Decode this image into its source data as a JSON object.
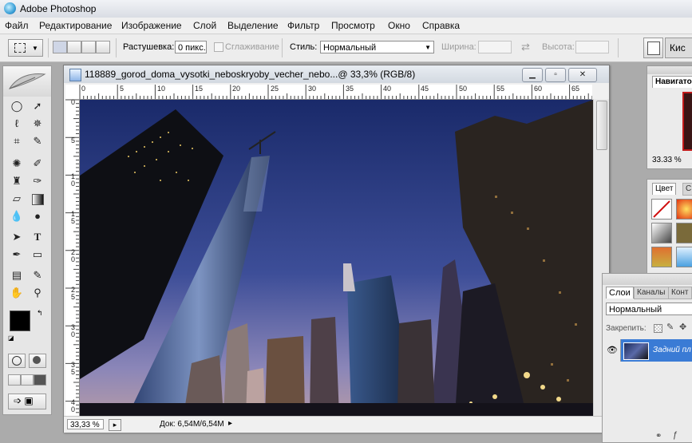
{
  "app": {
    "title": "Adobe Photoshop"
  },
  "menu": {
    "items": [
      "Файл",
      "Редактирование",
      "Изображение",
      "Слой",
      "Выделение",
      "Фильтр",
      "Просмотр",
      "Окно",
      "Справка"
    ]
  },
  "options": {
    "feather_label": "Растушевка:",
    "feather_value": "0 пикс.",
    "antialias_label": "Сглаживание",
    "style_label": "Стиль:",
    "style_value": "Нормальный",
    "width_label": "Ширина:",
    "height_label": "Высота:",
    "brushes_label": "Кис"
  },
  "document": {
    "title": "118889_gorod_doma_vysotki_neboskryoby_vecher_nebo...@ 33,3% (RGB/8)",
    "zoom": "33,33 %",
    "doc_info": "Док: 6,54M/6,54M",
    "hruler_labels": [
      "0",
      "5",
      "10",
      "15",
      "20",
      "25",
      "30",
      "35",
      "40",
      "45",
      "50",
      "55",
      "60",
      "65"
    ],
    "vruler_labels": [
      "0",
      "5",
      "1 0",
      "1 5",
      "2 0",
      "2 5",
      "3 0",
      "3 5",
      "4 0"
    ]
  },
  "navigator": {
    "tab_label": "Навигато",
    "zoom": "33.33 %"
  },
  "color_panel": {
    "tab_color": "Цвет",
    "tab_other": "С"
  },
  "layers": {
    "tab_layers": "Слои",
    "tab_channels": "Каналы",
    "tab_paths": "Конт",
    "blend_mode": "Нормальный",
    "lock_label": "Закрепить:",
    "layer_name": "Задний пл"
  },
  "colors": {
    "foreground": "#000000",
    "background": "#ffffff",
    "layer_selected": "#3a7bd5"
  }
}
